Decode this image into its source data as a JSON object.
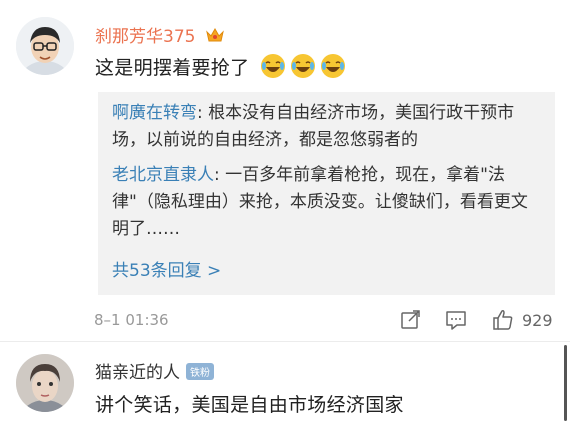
{
  "comment1": {
    "username": "刹那芳华375",
    "text": "这是明摆着要抢了",
    "replies": [
      {
        "name": "啊廣在转弯",
        "text": ": 根本没有自由经济市场，美国行政干预市场，以前说的自由经济，都是忽悠弱者的"
      },
      {
        "name": "老北京直隶人",
        "text": ": 一百多年前拿着枪抢，现在，拿着\"法律\"（隐私理由）来抢，本质没变。让傻缺们，看看更文明了……"
      }
    ],
    "more_replies": "共53条回复 >",
    "time": "8–1 01:36",
    "like_count": "929"
  },
  "comment2": {
    "username": "猫亲近的人",
    "badge": "铁粉",
    "text": "讲个笑话，美国是自由市场经济国家"
  },
  "colors": {
    "username_accent": "#eb7350",
    "link_blue": "#3a80b6",
    "reply_bg": "#f2f2f2"
  }
}
